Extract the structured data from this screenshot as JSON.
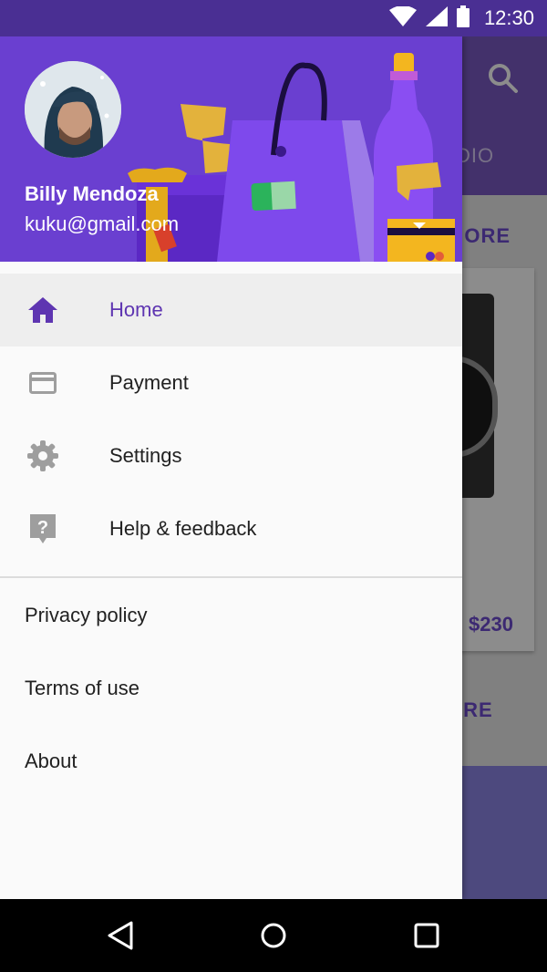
{
  "status": {
    "time": "12:30"
  },
  "background_app": {
    "tab_label": "DIO",
    "more_label_1": "MORE",
    "price": "$230",
    "more_label_2": "ORE"
  },
  "drawer": {
    "user": {
      "name": "Billy Mendoza",
      "email": "kuku@gmail.com"
    },
    "primary_items": [
      {
        "label": "Home",
        "icon": "home-icon",
        "active": true
      },
      {
        "label": "Payment",
        "icon": "credit-card-icon",
        "active": false
      },
      {
        "label": "Settings",
        "icon": "gear-icon",
        "active": false
      },
      {
        "label": "Help & feedback",
        "icon": "help-icon",
        "active": false
      }
    ],
    "secondary_items": [
      {
        "label": "Privacy policy"
      },
      {
        "label": "Terms of use"
      },
      {
        "label": "About"
      }
    ]
  },
  "colors": {
    "accent": "#5e35b1",
    "header": "#6a3fd0",
    "status_bar": "#4a2f93",
    "icon_active": "#5e35b1",
    "icon_inactive": "#9e9e9e"
  }
}
